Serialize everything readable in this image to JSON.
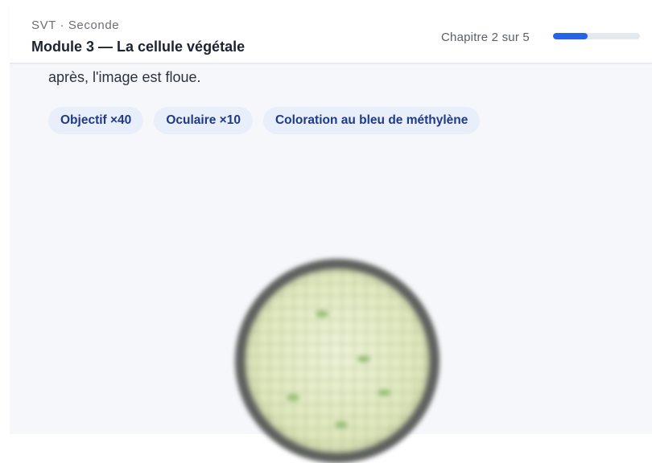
{
  "header": {
    "kicker": "SVT · Seconde",
    "title": "Module 3 — La cellule végétale",
    "progress_text": "Chapitre 2 sur 5",
    "progress_fraction": 0.4
  },
  "content": {
    "text": "après, l'image est floue.",
    "chips": [
      {
        "label": "Objectif ×40"
      },
      {
        "label": "Oculaire ×10"
      },
      {
        "label": "Coloration au bleu de méthylène"
      }
    ]
  },
  "colors": {
    "accent": "#2563eb",
    "chip_bg": "#e9eefb",
    "chip_text": "#1e3a8a"
  }
}
